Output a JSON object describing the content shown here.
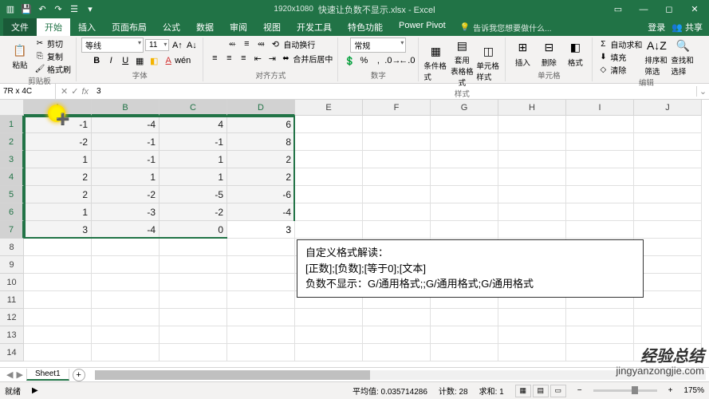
{
  "window": {
    "dims_label": "1920x1080",
    "title": "快速让负数不显示.xlsx - Excel",
    "login": "登录",
    "share": "共享"
  },
  "tabs": {
    "items": [
      {
        "label": "文件",
        "kind": "file"
      },
      {
        "label": "开始",
        "kind": "active"
      },
      {
        "label": "插入",
        "kind": ""
      },
      {
        "label": "页面布局",
        "kind": ""
      },
      {
        "label": "公式",
        "kind": ""
      },
      {
        "label": "数据",
        "kind": ""
      },
      {
        "label": "审阅",
        "kind": ""
      },
      {
        "label": "视图",
        "kind": ""
      },
      {
        "label": "开发工具",
        "kind": ""
      },
      {
        "label": "特色功能",
        "kind": ""
      },
      {
        "label": "Power Pivot",
        "kind": ""
      }
    ],
    "tellme": "告诉我您想要做什么..."
  },
  "ribbon": {
    "clipboard": {
      "paste": "粘贴",
      "cut": "剪切",
      "copy": "复制",
      "brush": "格式刷",
      "group": "剪贴板"
    },
    "font": {
      "name": "等线",
      "size": "11",
      "group": "字体"
    },
    "align": {
      "merge": "合并后居中",
      "wrap": "自动换行",
      "group": "对齐方式"
    },
    "number": {
      "format": "常规",
      "group": "数字"
    },
    "styles": {
      "cond": "条件格式",
      "table": "套用\n表格格式",
      "cell": "单元格样式",
      "group": "样式"
    },
    "cells": {
      "insert": "插入",
      "delete": "删除",
      "format": "格式",
      "group": "单元格"
    },
    "editing": {
      "sum": "自动求和",
      "fill": "填充",
      "clear": "清除",
      "sort": "排序和筛选",
      "find": "查找和选择",
      "group": "编辑"
    }
  },
  "namebox": "7R x 4C",
  "formula": "3",
  "columns": [
    "A",
    "B",
    "C",
    "D",
    "E",
    "F",
    "G",
    "H",
    "I",
    "J"
  ],
  "rows": [
    1,
    2,
    3,
    4,
    5,
    6,
    7,
    8,
    9,
    10,
    11,
    12,
    13,
    14
  ],
  "sel_cols": 4,
  "sel_rows": 7,
  "grid": [
    [
      "-1",
      "-4",
      "4",
      "6"
    ],
    [
      "-2",
      "-1",
      "-1",
      "8"
    ],
    [
      "1",
      "-1",
      "1",
      "2"
    ],
    [
      "2",
      "1",
      "1",
      "2"
    ],
    [
      "2",
      "-2",
      "-5",
      "-6"
    ],
    [
      "1",
      "-3",
      "-2",
      "-4"
    ],
    [
      "3",
      "-4",
      "0",
      "3"
    ]
  ],
  "textbox": {
    "l1": "自定义格式解读：",
    "l2": "[正数];[负数];[等于0];[文本]",
    "l3": "负数不显示：G/通用格式;;G/通用格式;G/通用格式"
  },
  "sheet": {
    "active": "Sheet1"
  },
  "status": {
    "mode": "就绪",
    "avg_label": "平均值:",
    "avg": "0.035714286",
    "count_label": "计数:",
    "count": "28",
    "sum_label": "求和:",
    "sum": "1",
    "zoom": "175%"
  },
  "watermark": {
    "brand": "经验总结",
    "site": "jingyanzongjie.com"
  }
}
